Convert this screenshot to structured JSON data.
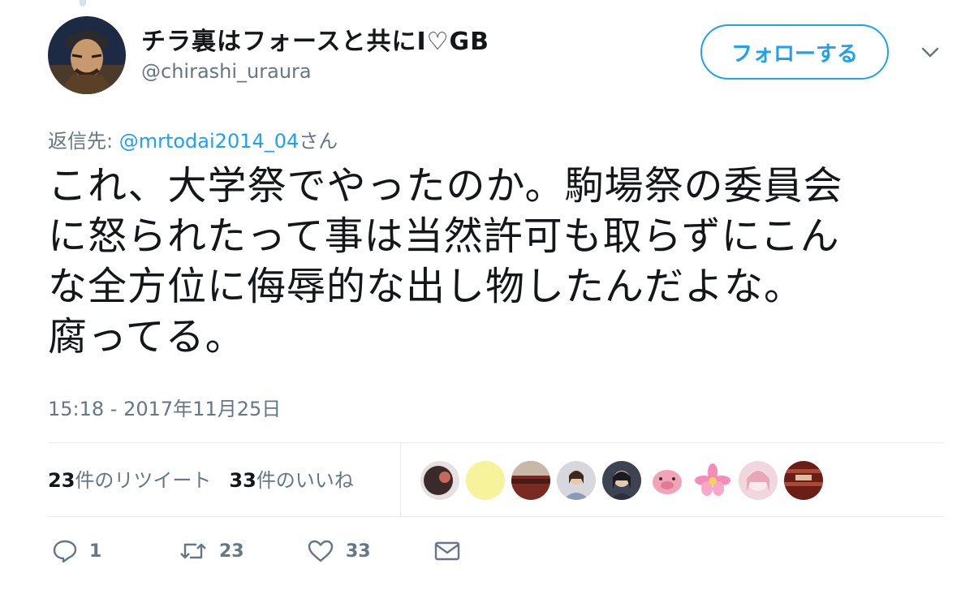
{
  "user": {
    "display_name": "チラ裏はフォースと共にI♡GB",
    "handle": "@chirashi_uraura",
    "avatar_icon": "samurai-avatar"
  },
  "follow_button": {
    "label": "フォローする",
    "color": "#1da1f2"
  },
  "more_menu": {
    "icon": "chevron-down-icon"
  },
  "reply_to": {
    "prefix": "返信先: ",
    "mention": "@mrtodai2014_04",
    "suffix": "さん"
  },
  "tweet": {
    "lines": [
      "これ、大学祭でやったのか。駒場祭の委員会",
      "に怒られたって事は当然許可も取らずにこん",
      "な全方位に侮辱的な出し物したんだよな。",
      "腐ってる。"
    ],
    "timestamp": "15:18 - 2017年11月25日"
  },
  "stats": {
    "retweets_count": "23",
    "retweets_label": "件のリツイート",
    "likes_count": "33",
    "likes_label": "件のいいね"
  },
  "likers": [
    {
      "icon": "liker-avatar-1",
      "color": "#3a2a2a"
    },
    {
      "icon": "liker-avatar-2",
      "color": "#f6f39a"
    },
    {
      "icon": "liker-avatar-3",
      "color": "#7a2a22"
    },
    {
      "icon": "liker-avatar-4",
      "color": "#d7d7dd"
    },
    {
      "icon": "liker-avatar-5",
      "color": "#3d4350"
    },
    {
      "icon": "liker-avatar-6",
      "color": "#f2a3b7"
    },
    {
      "icon": "liker-avatar-7",
      "color": "#f58bb9"
    },
    {
      "icon": "liker-avatar-8",
      "color": "#f0d6de"
    },
    {
      "icon": "liker-avatar-9",
      "color": "#6a1e16"
    }
  ],
  "actions": {
    "reply_count": "1",
    "retweet_count": "23",
    "like_count": "33"
  },
  "colors": {
    "accent": "#1da1f2",
    "text": "#14171a",
    "muted": "#657786",
    "divider": "#e6ecf0"
  }
}
